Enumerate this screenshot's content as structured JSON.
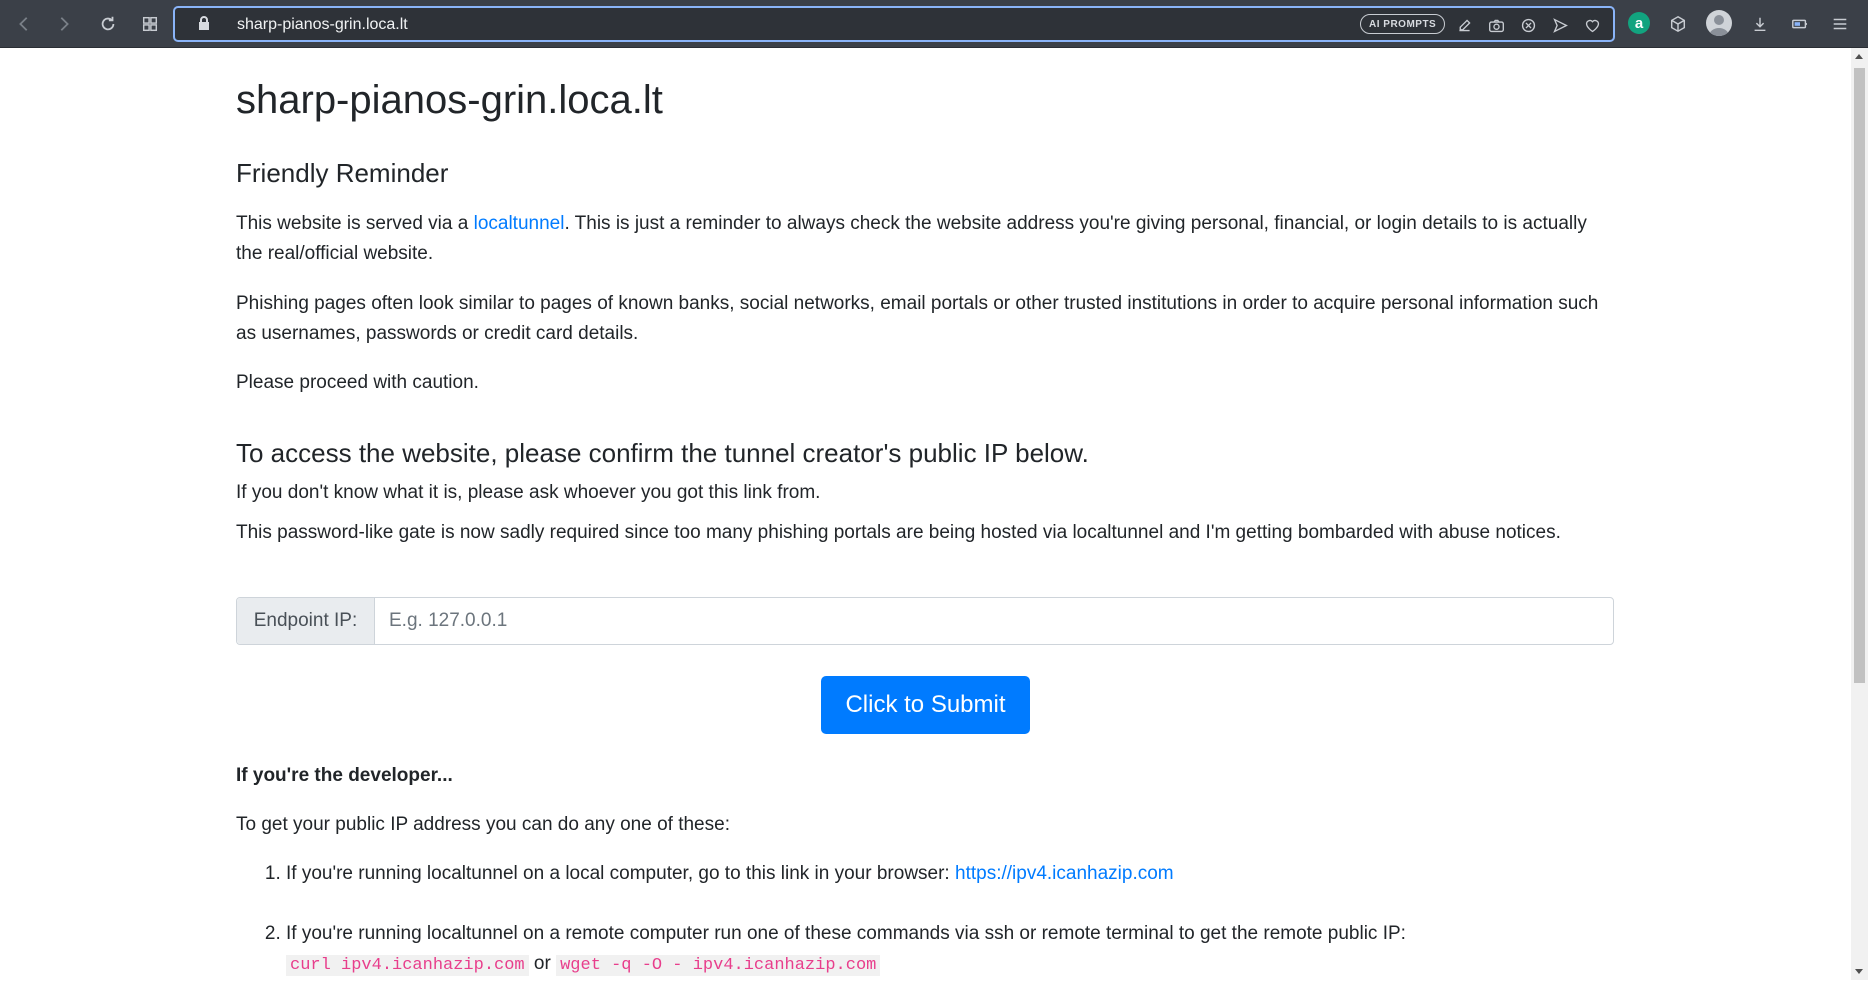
{
  "browser": {
    "url": "sharp-pianos-grin.loca.lt",
    "ai_prompts_label": "AI PROMPTS",
    "extension_letter": "a"
  },
  "page": {
    "title": "sharp-pianos-grin.loca.lt",
    "reminder_heading": "Friendly Reminder",
    "para1_before": "This website is served via a ",
    "para1_link": "localtunnel",
    "para1_after": ". This is just a reminder to always check the website address you're giving personal, financial, or login details to is actually the real/official website.",
    "para2": "Phishing pages often look similar to pages of known banks, social networks, email portals or other trusted institutions in order to acquire personal information such as usernames, passwords or credit card details.",
    "para3": "Please proceed with caution.",
    "access_heading": "To access the website, please confirm the tunnel creator's public IP below.",
    "access_para1": "If you don't know what it is, please ask whoever you got this link from.",
    "access_para2": "This password-like gate is now sadly required since too many phishing portals are being hosted via localtunnel and I'm getting bombarded with abuse notices.",
    "endpoint_label": "Endpoint IP:",
    "endpoint_placeholder": "E.g. 127.0.0.1",
    "endpoint_value": "",
    "submit_label": "Click to Submit",
    "developer_heading": "If you're the developer...",
    "developer_intro": "To get your public IP address you can do any one of these:",
    "step1_text": "If you're running localtunnel on a local computer, go to this link in your browser: ",
    "step1_link": "https://ipv4.icanhazip.com",
    "step2_text": "If you're running localtunnel on a remote computer run one of these commands via ssh or remote terminal to get the remote public IP:",
    "step2_cmd1": "curl ipv4.icanhazip.com",
    "step2_or": " or ",
    "step2_cmd2": "wget -q -O - ipv4.icanhazip.com"
  },
  "colors": {
    "link": "#007bff",
    "button": "#007bff",
    "code": "#e83e8c"
  }
}
